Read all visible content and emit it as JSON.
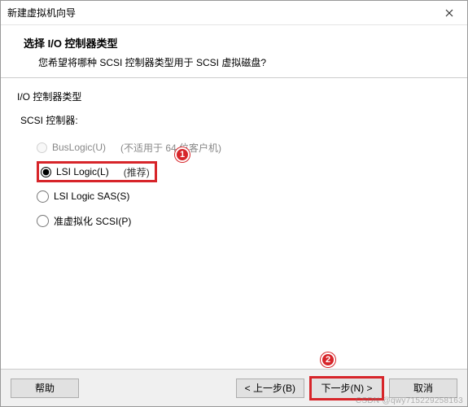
{
  "window": {
    "title": "新建虚拟机向导"
  },
  "header": {
    "title": "选择 I/O 控制器类型",
    "subtitle": "您希望将哪种 SCSI 控制器类型用于 SCSI 虚拟磁盘?"
  },
  "group": {
    "label": "I/O 控制器类型",
    "sublabel": "SCSI 控制器:"
  },
  "options": {
    "buslogic": {
      "label": "BusLogic(U)",
      "note": "(不适用于 64 位客户机)"
    },
    "lsilogic": {
      "label": "LSI Logic(L)",
      "note": "(推荐)"
    },
    "lsisas": {
      "label": "LSI Logic SAS(S)"
    },
    "pvscsi": {
      "label": "准虚拟化 SCSI(P)"
    }
  },
  "callouts": {
    "one": "1",
    "two": "2"
  },
  "footer": {
    "help": "帮助",
    "back": "< 上一步(B)",
    "next": "下一步(N) >",
    "cancel": "取消"
  },
  "watermark": "CSDN @qwy715229258163"
}
